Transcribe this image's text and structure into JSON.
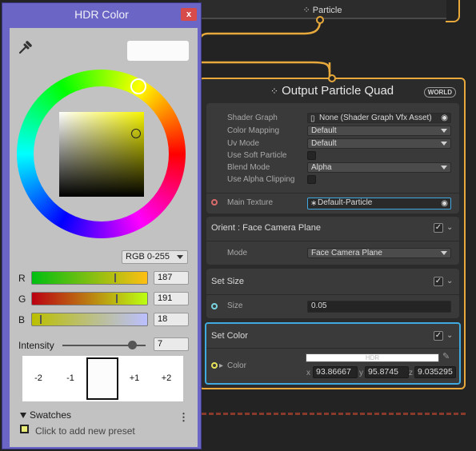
{
  "graph": {
    "top_node": {
      "title": "Particle",
      "icon": "vfx-sparkle-icon"
    },
    "output_node": {
      "title": "Output Particle Quad",
      "space_badge": "WORLD",
      "properties": [
        {
          "label": "Shader Graph",
          "value": "None (Shader Graph Vfx Asset)",
          "kind": "object"
        },
        {
          "label": "Color Mapping",
          "value": "Default",
          "kind": "dropdown"
        },
        {
          "label": "Uv Mode",
          "value": "Default",
          "kind": "dropdown"
        },
        {
          "label": "Use Soft Particle",
          "value": "",
          "kind": "checkbox"
        },
        {
          "label": "Blend Mode",
          "value": "Alpha",
          "kind": "dropdown"
        },
        {
          "label": "Use Alpha Clipping",
          "value": "",
          "kind": "checkbox"
        }
      ],
      "main_texture": {
        "label": "Main Texture",
        "value": "Default-Particle"
      },
      "blocks": {
        "orient": {
          "title": "Orient : Face Camera Plane",
          "mode_label": "Mode",
          "mode_value": "Face Camera Plane"
        },
        "set_size": {
          "title": "Set Size",
          "size_label": "Size",
          "size_value": "0.05"
        },
        "set_color": {
          "title": "Set Color",
          "color_label": "Color",
          "hdr_tag": "HDR",
          "x_label": "x",
          "x_value": "93.86667",
          "y_label": "y",
          "y_value": "95.8745",
          "z_label": "z",
          "z_value": "9.035295"
        }
      }
    }
  },
  "picker": {
    "title": "HDR Color",
    "close_label": "x",
    "mode": "RGB 0-255",
    "channels": {
      "r": {
        "label": "R",
        "value": "187",
        "fraction": 0.733
      },
      "g": {
        "label": "G",
        "value": "191",
        "fraction": 0.749
      },
      "b": {
        "label": "B",
        "value": "18",
        "fraction": 0.071
      }
    },
    "intensity": {
      "label": "Intensity",
      "value": "7",
      "fraction": 0.84
    },
    "exposure": {
      "minus2": "-2",
      "minus1": "-1",
      "plus1": "+1",
      "plus2": "+2"
    },
    "swatches": {
      "title": "Swatches",
      "hint": "Click to add new preset"
    },
    "colors": {
      "accent": "#e7a93b",
      "selected_block": "#3fa9e0",
      "window": "#6b66c6",
      "picked": "#bbbf12"
    }
  }
}
